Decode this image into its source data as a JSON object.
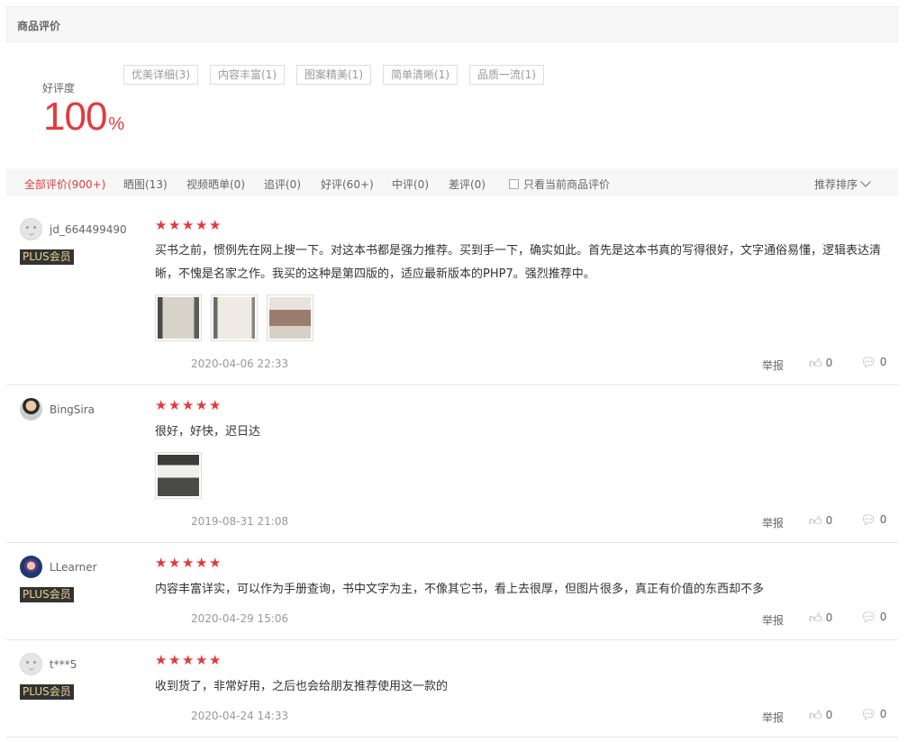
{
  "header": {
    "title": "商品评价"
  },
  "rating": {
    "label": "好评度",
    "value": "100",
    "unit": "%"
  },
  "tags": [
    "优美详细(3)",
    "内容丰富(1)",
    "图案精美(1)",
    "简单清晰(1)",
    "品质一流(1)"
  ],
  "tabs": {
    "all": "全部评价(900+)",
    "pics": "晒图(13)",
    "video": "视频晒单(0)",
    "append": "追评(0)",
    "good": "好评(60+)",
    "medium": "中评(0)",
    "bad": "差评(0)",
    "current_only": "只看当前商品评价",
    "sort": "推荐排序"
  },
  "plus_label": "PLUS会员",
  "report_label": "举报",
  "reviews": [
    {
      "user": "jd_664499490",
      "stars": 5,
      "content": "买书之前，惯例先在网上搜一下。对这本书都是强力推荐。买到手一下，确实如此。首先是这本书真的写得很好，文字通俗易懂，逻辑表达清晰，不愧是名家之作。我买的这种是第四版的，适应最新版本的PHP7。强烈推荐中。",
      "date": "2020-04-06 22:33",
      "likes": "0",
      "replies": "0"
    },
    {
      "user": "BingSira",
      "stars": 5,
      "content": "很好，好快，迟日达",
      "date": "2019-08-31 21:08",
      "likes": "0",
      "replies": "0"
    },
    {
      "user": "LLearner",
      "stars": 5,
      "content": "内容丰富详实，可以作为手册查询，书中文字为主，不像其它书，看上去很厚，但图片很多，真正有价值的东西却不多",
      "date": "2020-04-29 15:06",
      "likes": "0",
      "replies": "0"
    },
    {
      "user": "t***5",
      "stars": 5,
      "content": "收到货了，非常好用，之后也会给朋友推荐使用这一款的",
      "date": "2020-04-24 14:33",
      "likes": "0",
      "replies": "0"
    }
  ],
  "colors": {
    "accent": "#e4393c",
    "plus_bg": "#333333",
    "plus_text": "#e5d58c"
  },
  "icons": {
    "star": "star-icon",
    "like": "thumbs-up-icon",
    "reply": "comment-icon",
    "sort": "chevron-down-icon",
    "checkbox": "checkbox-icon"
  }
}
